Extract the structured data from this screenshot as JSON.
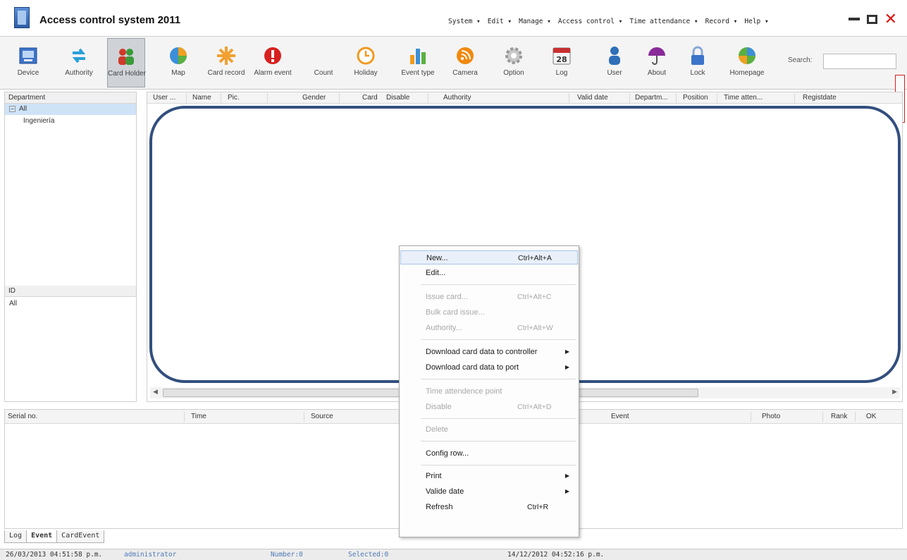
{
  "window": {
    "title": "Access control system 2011"
  },
  "menubar": [
    "System ▾",
    "Edit ▾",
    "Manage ▾",
    "Access control ▾",
    "Time attendance ▾",
    "Record ▾",
    "Help ▾"
  ],
  "toolbar": {
    "buttons": [
      {
        "label": "Device",
        "icon": "device-icon"
      },
      {
        "label": "Authority",
        "icon": "authority-icon"
      },
      {
        "label": "Card Holder",
        "icon": "card-holder-icon",
        "active": true
      },
      {
        "label": "Map",
        "icon": "map-icon"
      },
      {
        "label": "Card record",
        "icon": "card-record-icon"
      },
      {
        "label": "Alarm event",
        "icon": "alarm-icon"
      },
      {
        "label": "Count",
        "icon": "count-icon"
      },
      {
        "label": "Holiday",
        "icon": "clock-icon"
      },
      {
        "label": "Event type",
        "icon": "bar-chart-icon"
      },
      {
        "label": "Camera",
        "icon": "camera-icon"
      },
      {
        "label": "Option",
        "icon": "gear-icon"
      },
      {
        "label": "Log",
        "icon": "calendar-icon"
      },
      {
        "label": "User",
        "icon": "user-icon"
      },
      {
        "label": "About",
        "icon": "umbrella-icon"
      },
      {
        "label": "Lock",
        "icon": "lock-icon"
      },
      {
        "label": "Homepage",
        "icon": "globe-icon"
      }
    ],
    "calendar_day": "28",
    "search_label": "Search:",
    "search_value": ""
  },
  "left_panel": {
    "department_header": "Department",
    "tree_root": "All",
    "tree_toggle": "−",
    "tree_child": "Ingeniería",
    "id_header": "ID",
    "id_value": "All"
  },
  "grid": {
    "columns": [
      "User ...",
      "Name",
      "Pic.",
      "Gender",
      "Card",
      "Disable",
      "Authority",
      "Valid date",
      "Departm...",
      "Position",
      "Time atten...",
      "Registdate"
    ]
  },
  "event_grid": {
    "columns": [
      "Serial no.",
      "Time",
      "Source",
      "Event",
      "Photo",
      "Rank",
      "OK"
    ]
  },
  "tabs": [
    "Log",
    "Event",
    "CardEvent"
  ],
  "statusbar": {
    "login_time": "26/03/2013 04:51:58 p.m.",
    "user": "administrator",
    "number": "Number:0",
    "selected": "Selected:0",
    "current_time": "14/12/2012 04:52:16 p.m."
  },
  "context_menu": {
    "items": [
      {
        "label": "New...",
        "shortcut": "Ctrl+Alt+A",
        "disabled": false,
        "hover": true
      },
      {
        "label": "Edit...",
        "shortcut": "",
        "disabled": false
      },
      {
        "label": "Issue card...",
        "shortcut": "Ctrl+Alt+C",
        "disabled": true
      },
      {
        "label": "Bulk card issue...",
        "shortcut": "",
        "disabled": true
      },
      {
        "label": "Authority...",
        "shortcut": "Ctrl+Alt+W",
        "disabled": true
      },
      {
        "label": "Download card data to controller",
        "shortcut": "",
        "submenu": true
      },
      {
        "label": "Download card data to port",
        "shortcut": "",
        "submenu": true
      },
      {
        "label": "Time attendence point",
        "shortcut": "",
        "disabled": true
      },
      {
        "label": "Disable",
        "shortcut": "Ctrl+Alt+D",
        "disabled": true
      },
      {
        "label": "Delete",
        "shortcut": "",
        "disabled": true
      },
      {
        "label": "Config row...",
        "shortcut": ""
      },
      {
        "label": "Print",
        "shortcut": "",
        "submenu": true
      },
      {
        "label": "Valide date",
        "shortcut": "",
        "submenu": true
      },
      {
        "label": "Refresh",
        "shortcut": "Ctrl+R"
      }
    ],
    "submenu_arrow": "▶"
  },
  "colors": {
    "accent_oval": "#324f7e",
    "close_button": "#e01010",
    "tree_selection": "#cfe3f7"
  }
}
